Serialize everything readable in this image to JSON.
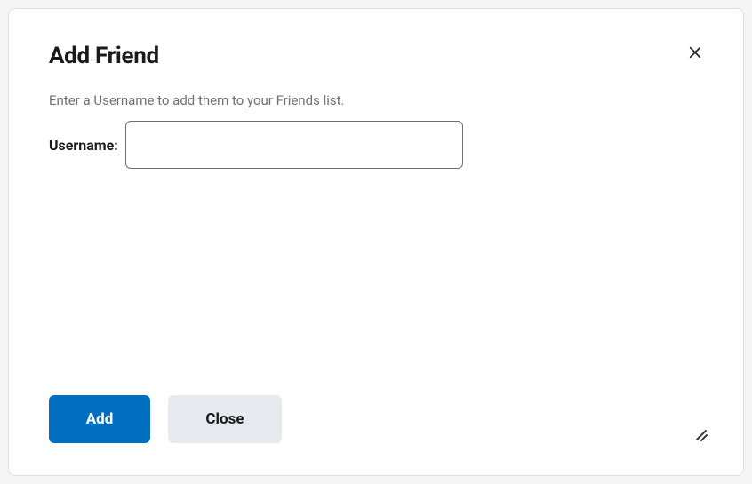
{
  "dialog": {
    "title": "Add Friend",
    "instruction": "Enter a Username to add them to your Friends list.",
    "username_label": "Username:",
    "username_value": "",
    "actions": {
      "add_label": "Add",
      "close_label": "Close"
    }
  }
}
